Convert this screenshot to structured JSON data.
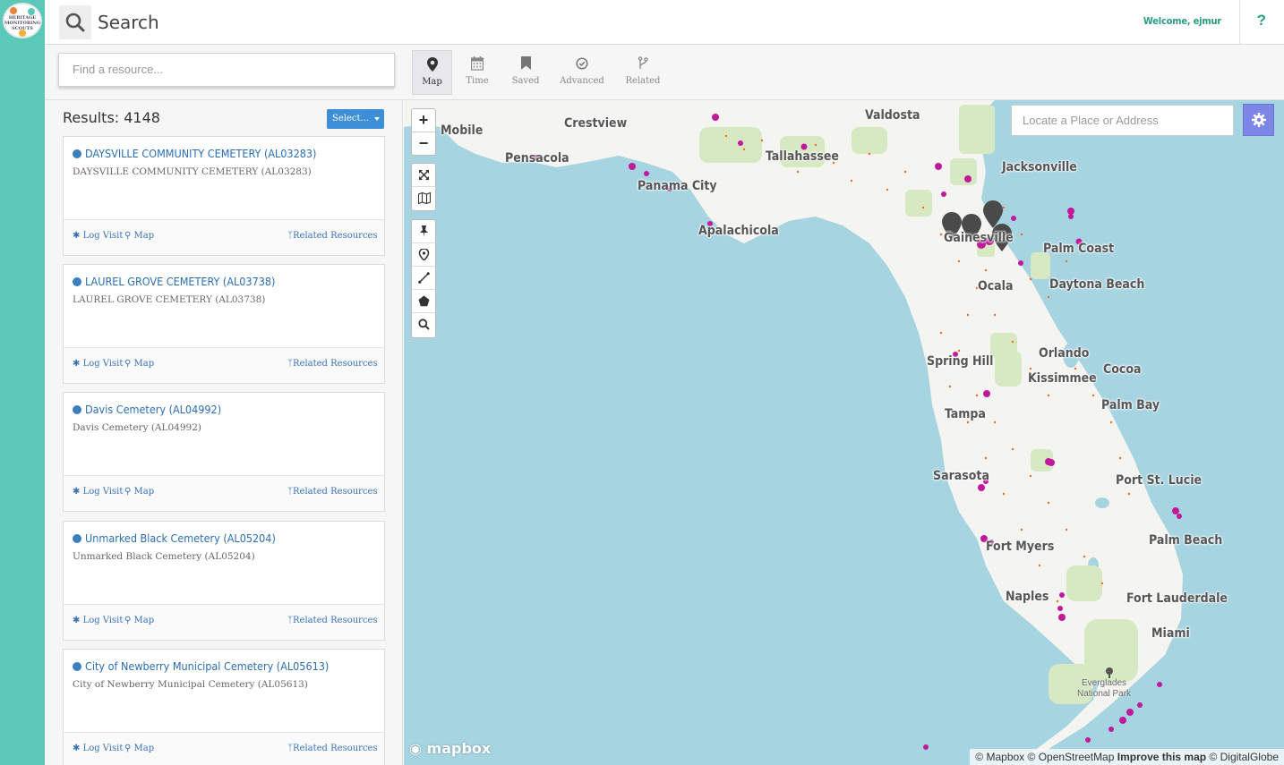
{
  "app": {
    "logo_text": "HERITAGE MONITORING SCOUTS"
  },
  "header": {
    "title": "Search",
    "welcome": "Welcome, ejmur",
    "help": "?"
  },
  "search": {
    "placeholder": "Find a resource..."
  },
  "tabs": [
    {
      "label": "Map",
      "icon": "map-marker-icon",
      "active": true
    },
    {
      "label": "Time",
      "icon": "calendar-icon",
      "active": false
    },
    {
      "label": "Saved",
      "icon": "bookmark-icon",
      "active": false
    },
    {
      "label": "Advanced",
      "icon": "check-circle-icon",
      "active": false
    },
    {
      "label": "Related",
      "icon": "fork-icon",
      "active": false
    }
  ],
  "results": {
    "count_label": "Results: 4148",
    "select_label": "Select...",
    "items": [
      {
        "title": "DAYSVILLE COMMUNITY CEMETERY (AL03283)",
        "subtitle": "DAYSVILLE COMMUNITY CEMETERY (AL03283)",
        "log_visit": "Log Visit",
        "map": "Map",
        "related": "Related Resources"
      },
      {
        "title": "LAUREL GROVE CEMETERY (AL03738)",
        "subtitle": "LAUREL GROVE CEMETERY (AL03738)",
        "log_visit": "Log Visit",
        "map": "Map",
        "related": "Related Resources"
      },
      {
        "title": "Davis Cemetery (AL04992)",
        "subtitle": "Davis Cemetery (AL04992)",
        "log_visit": "Log Visit",
        "map": "Map",
        "related": "Related Resources"
      },
      {
        "title": "Unmarked Black Cemetery (AL05204)",
        "subtitle": "Unmarked Black Cemetery (AL05204)",
        "log_visit": "Log Visit",
        "map": "Map",
        "related": "Related Resources"
      },
      {
        "title": "City of Newberry Municipal Cemetery (AL05613)",
        "subtitle": "City of Newberry Municipal Cemetery (AL05613)",
        "log_visit": "Log Visit",
        "map": "Map",
        "related": "Related Resources"
      }
    ]
  },
  "map": {
    "locate_placeholder": "Locate a Place or Address",
    "zoom_in": "+",
    "zoom_out": "−",
    "mapbox_label": "mapbox",
    "attribution": {
      "mapbox": "© Mapbox",
      "osm": "© OpenStreetMap",
      "improve": "Improve this map",
      "globe": "© DigitalGlobe"
    },
    "park_label": "Everglades\nNational Park",
    "cities": [
      {
        "name": "Mobile"
      },
      {
        "name": "Crestview"
      },
      {
        "name": "Valdosta"
      },
      {
        "name": "Pensacola"
      },
      {
        "name": "Tallahassee"
      },
      {
        "name": "Jacksonville"
      },
      {
        "name": "Panama City"
      },
      {
        "name": "Apalachicola"
      },
      {
        "name": "Gainesville"
      },
      {
        "name": "Palm Coast"
      },
      {
        "name": "Ocala"
      },
      {
        "name": "Daytona Beach"
      },
      {
        "name": "Orlando"
      },
      {
        "name": "Spring Hill"
      },
      {
        "name": "Cocoa"
      },
      {
        "name": "Kissimmee"
      },
      {
        "name": "Tampa"
      },
      {
        "name": "Palm Bay"
      },
      {
        "name": "Sarasota"
      },
      {
        "name": "Port St. Lucie"
      },
      {
        "name": "Fort Myers"
      },
      {
        "name": "Palm Beach"
      },
      {
        "name": "Naples"
      },
      {
        "name": "Fort Lauderdale"
      },
      {
        "name": "Miami"
      }
    ],
    "colors": {
      "water": "#a7d4e1",
      "land": "#f4f4f1",
      "parks": "#d6e9c2",
      "poi": "#c2189b",
      "dots": "#f26b1d"
    }
  }
}
